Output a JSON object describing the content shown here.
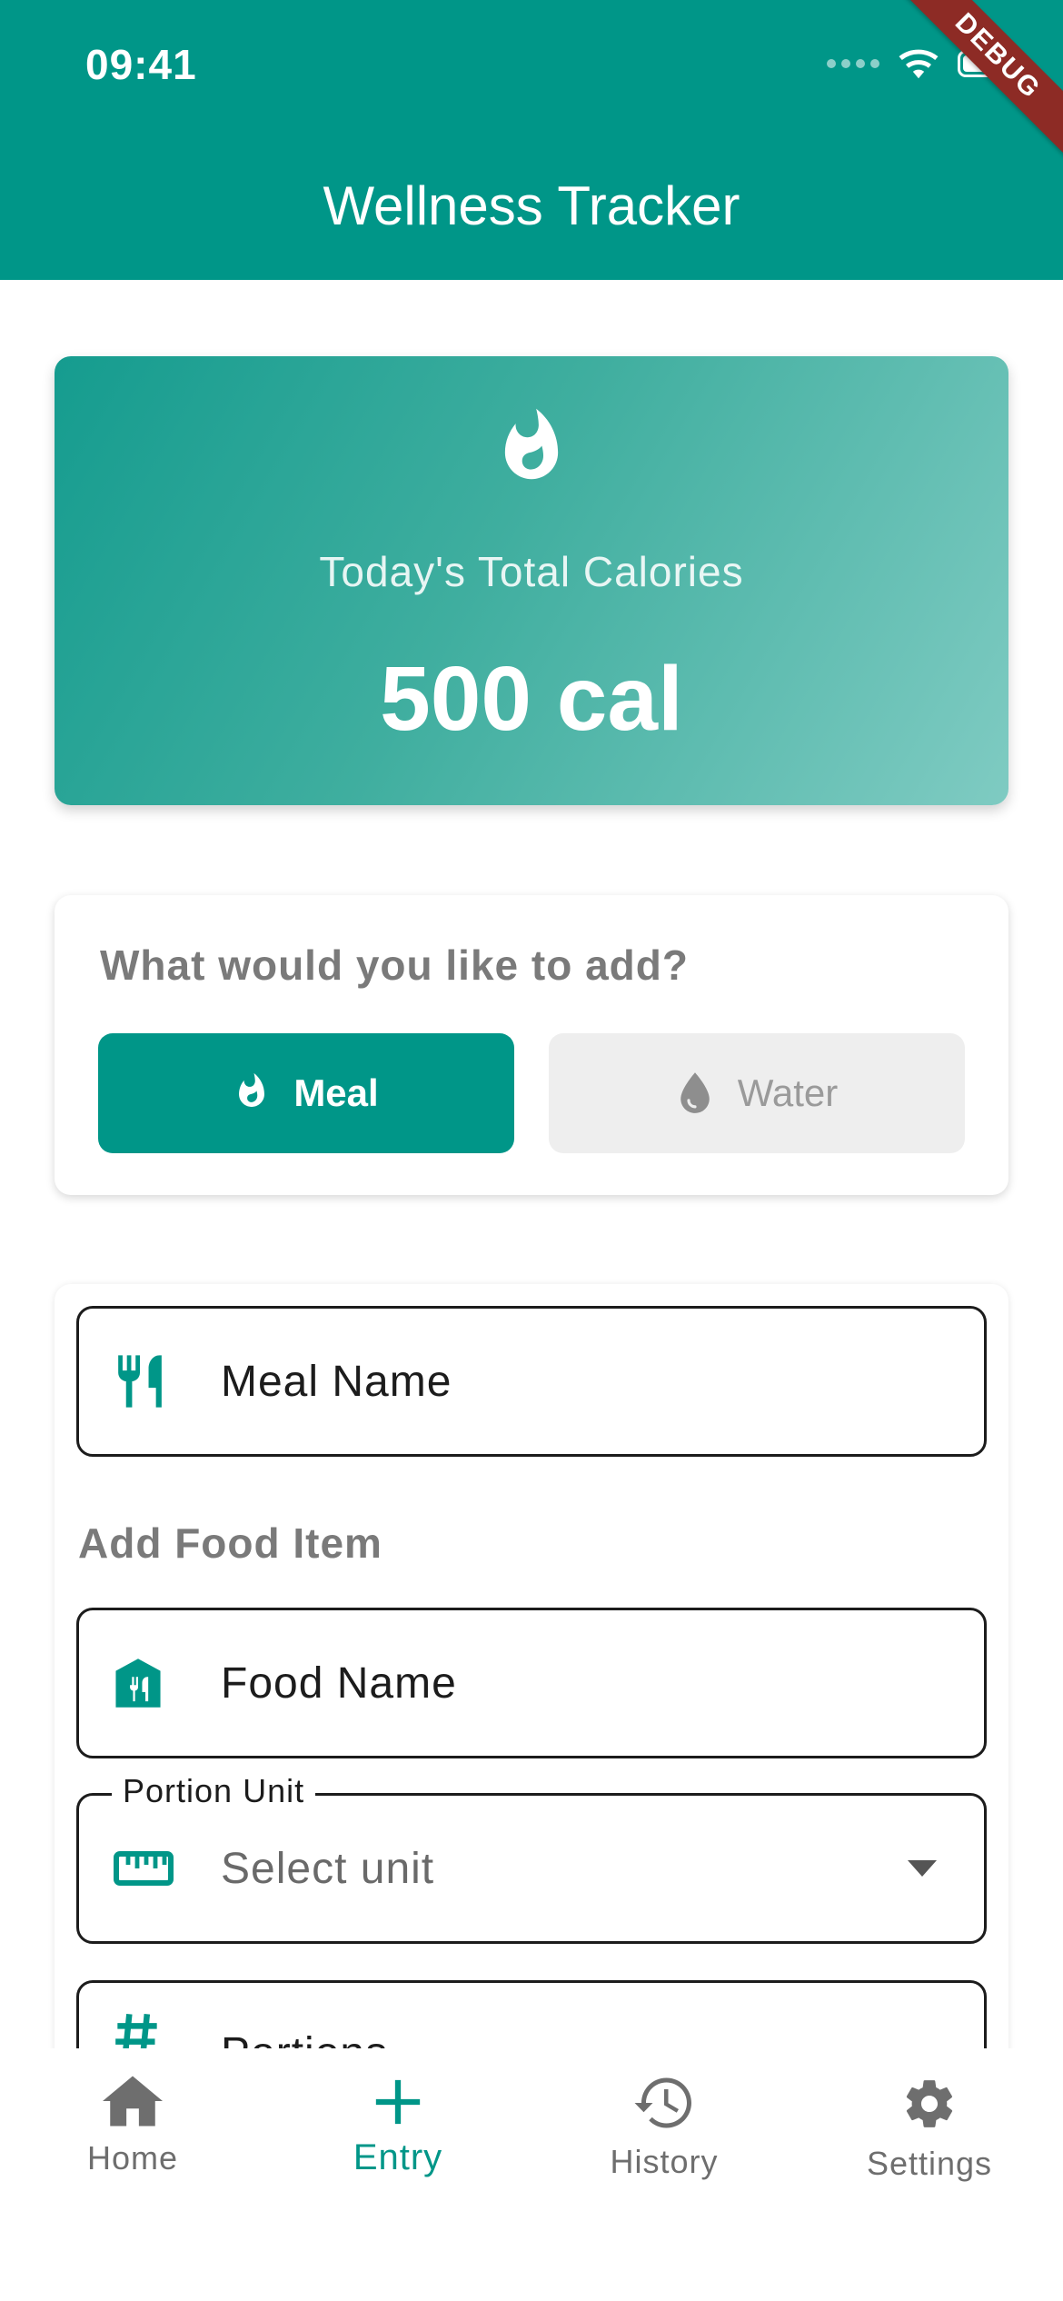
{
  "status_bar": {
    "time": "09:41"
  },
  "debug_banner": "DEBUG",
  "app_bar": {
    "title": "Wellness Tracker"
  },
  "calorie_card": {
    "icon": "fire-icon",
    "label": "Today's Total Calories",
    "value": "500 cal"
  },
  "add_type": {
    "question": "What would you like to add?",
    "options": [
      {
        "label": "Meal",
        "icon": "fire-icon",
        "selected": true
      },
      {
        "label": "Water",
        "icon": "water-drop-icon",
        "selected": false
      }
    ]
  },
  "form": {
    "meal_name": {
      "placeholder": "Meal Name",
      "icon": "restaurant-icon"
    },
    "section_title": "Add Food Item",
    "food_name": {
      "placeholder": "Food Name",
      "icon": "food-icon"
    },
    "portion_unit": {
      "label": "Portion Unit",
      "value": "Select unit",
      "icon": "ruler-icon"
    },
    "portions": {
      "placeholder": "Portions",
      "icon": "hash-icon"
    }
  },
  "bottom_nav": {
    "items": [
      {
        "label": "Home",
        "icon": "home-icon",
        "active": false
      },
      {
        "label": "Entry",
        "icon": "plus-icon",
        "active": true
      },
      {
        "label": "History",
        "icon": "history-icon",
        "active": false
      },
      {
        "label": "Settings",
        "icon": "gear-icon",
        "active": false
      }
    ]
  },
  "colors": {
    "primary": "#009688",
    "debug": "#8d2b25",
    "muted_text": "#7a7a7a"
  }
}
